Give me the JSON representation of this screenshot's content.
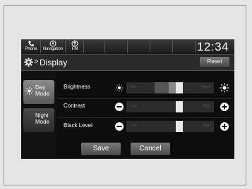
{
  "status_bar": {
    "phone_label": "Phone",
    "navigation_label": "Navigation",
    "fm_label": "FM",
    "clock": "12:34"
  },
  "header": {
    "title": "Display",
    "reset_label": "Reset"
  },
  "sidebar": {
    "day_mode_line1": "Day",
    "day_mode_line2": "Mode",
    "night_mode_line1": "Night",
    "night_mode_line2": "Mode"
  },
  "settings": {
    "brightness": {
      "label": "Brightness",
      "min_label": "Dim",
      "max_label": "Bright"
    },
    "contrast": {
      "label": "Contrast",
      "min_label": "Low",
      "max_label": "High"
    },
    "black_level": {
      "label": "Black Level",
      "min_label": "Low",
      "max_label": "High"
    }
  },
  "footer": {
    "save_label": "Save",
    "cancel_label": "Cancel"
  }
}
